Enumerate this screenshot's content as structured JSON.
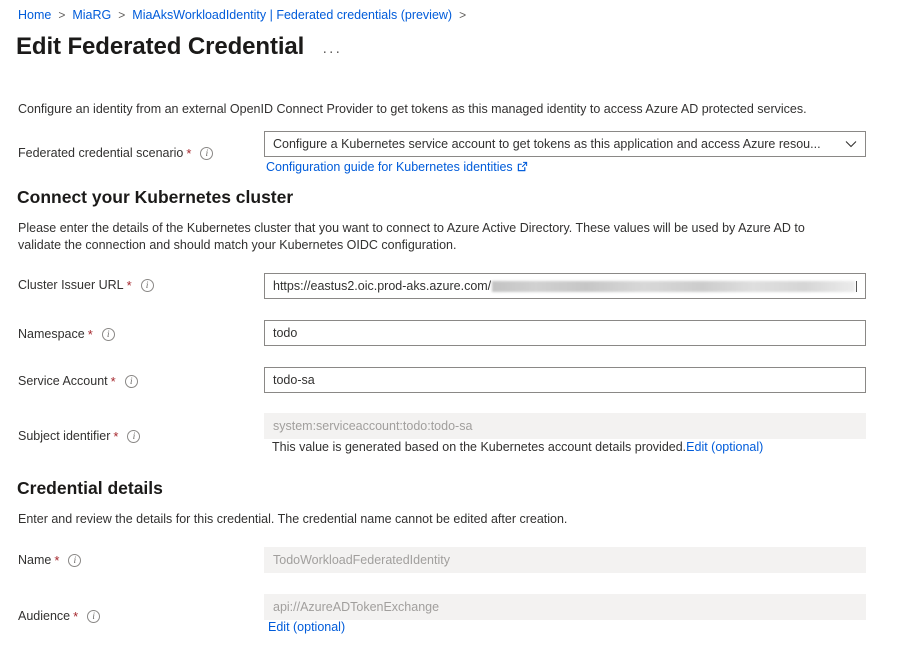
{
  "breadcrumb": {
    "items": [
      {
        "label": "Home"
      },
      {
        "label": "MiaRG"
      },
      {
        "label": "MiaAksWorkloadIdentity | Federated credentials (preview)"
      }
    ],
    "separator": ">"
  },
  "header": {
    "title": "Edit Federated Credential",
    "more_label": "···"
  },
  "intro": "Configure an identity from an external OpenID Connect Provider to get tokens as this managed identity to access Azure AD protected services.",
  "scenario": {
    "label": "Federated credential scenario",
    "required": "*",
    "value": "Configure a Kubernetes service account to get tokens as this application and access Azure resou...",
    "chevron": "∨",
    "guide_link": "Configuration guide for Kubernetes identities"
  },
  "cluster_section": {
    "heading": "Connect your Kubernetes cluster",
    "description": "Please enter the details of the Kubernetes cluster that you want to connect to Azure Active Directory. These values will be used by Azure AD to validate the connection and should match your Kubernetes OIDC configuration.",
    "issuer": {
      "label": "Cluster Issuer URL",
      "required": "*",
      "value": "https://eastus2.oic.prod-aks.azure.com/"
    },
    "namespace": {
      "label": "Namespace",
      "required": "*",
      "value": "todo"
    },
    "service_account": {
      "label": "Service Account",
      "required": "*",
      "value": "todo-sa"
    },
    "subject": {
      "label": "Subject identifier",
      "required": "*",
      "value": "system:serviceaccount:todo:todo-sa",
      "helper_text": "This value is generated based on the Kubernetes account details provided.",
      "edit_link": "Edit (optional)"
    }
  },
  "credential_section": {
    "heading": "Credential details",
    "description": "Enter and review the details for this credential. The credential name cannot be edited after creation.",
    "name": {
      "label": "Name",
      "required": "*",
      "value": "TodoWorkloadFederatedIdentity"
    },
    "audience": {
      "label": "Audience",
      "required": "*",
      "value": "api://AzureADTokenExchange",
      "edit_link": "Edit (optional)"
    }
  },
  "colors": {
    "link": "#015cda",
    "required": "#a4262c",
    "text": "#323130",
    "disabled_bg": "#f3f2f1",
    "border": "#8a8886"
  }
}
